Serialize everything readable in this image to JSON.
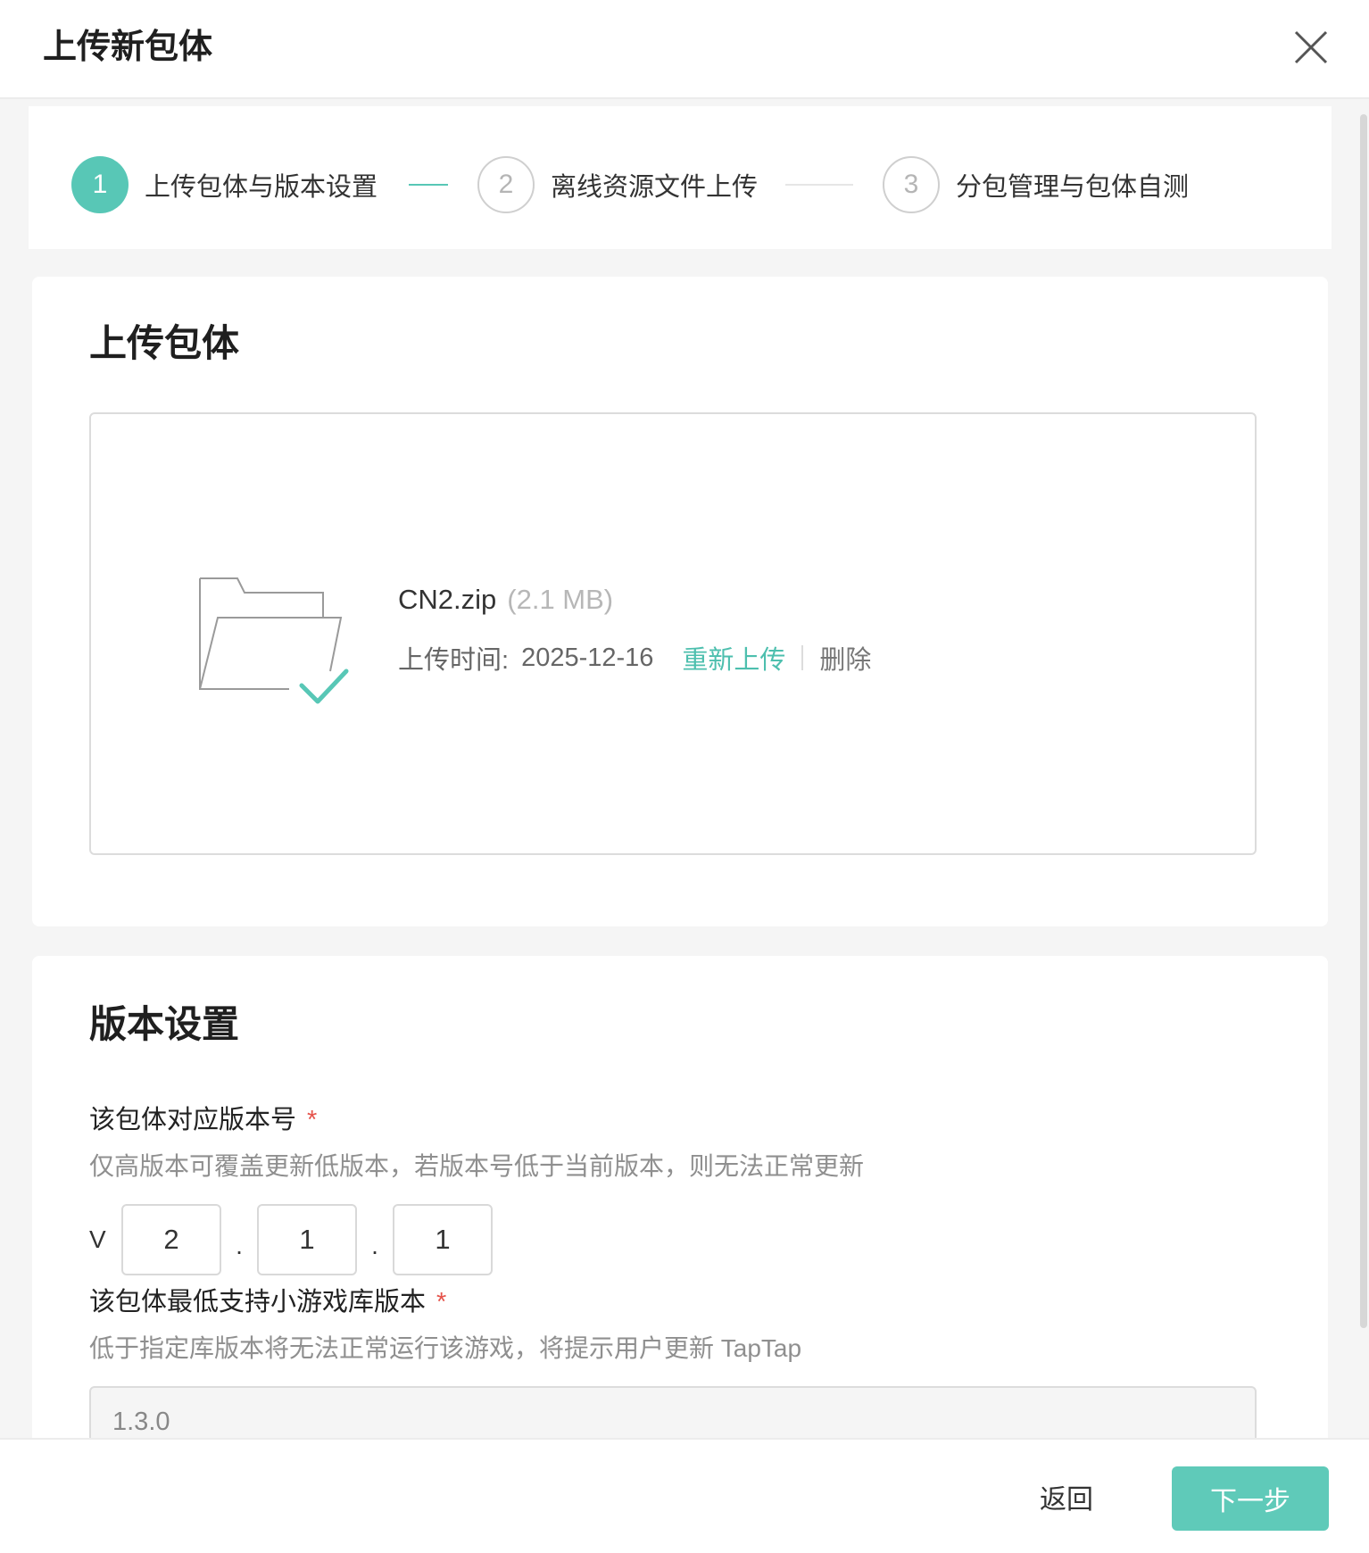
{
  "header": {
    "title": "上传新包体"
  },
  "steps": [
    {
      "num": "1",
      "label": "上传包体与版本设置",
      "state": "active"
    },
    {
      "num": "2",
      "label": "离线资源文件上传",
      "state": "idle"
    },
    {
      "num": "3",
      "label": "分包管理与包体自测",
      "state": "idle"
    }
  ],
  "upload": {
    "title": "上传包体",
    "file_name": "CN2.zip",
    "file_size": "(2.1 MB)",
    "time_label": "上传时间:",
    "time_value": "2025-12-16",
    "reupload_label": "重新上传",
    "delete_label": "删除"
  },
  "version": {
    "title": "版本设置",
    "version_label": "该包体对应版本号",
    "required_mark": "*",
    "version_hint": "仅高版本可覆盖更新低版本，若版本号低于当前版本，则无法正常更新",
    "prefix": "V",
    "separator": ".",
    "major": "2",
    "minor": "1",
    "patch": "1",
    "lib_label": "该包体最低支持小游戏库版本",
    "lib_hint": "低于指定库版本将无法正常运行该游戏，将提示用户更新 TapTap",
    "lib_value": "1.3.0"
  },
  "footer": {
    "back_label": "返回",
    "next_label": "下一步"
  },
  "colors": {
    "accent": "#58c7b6",
    "required": "#e5534b",
    "button": "#5fcab9"
  }
}
